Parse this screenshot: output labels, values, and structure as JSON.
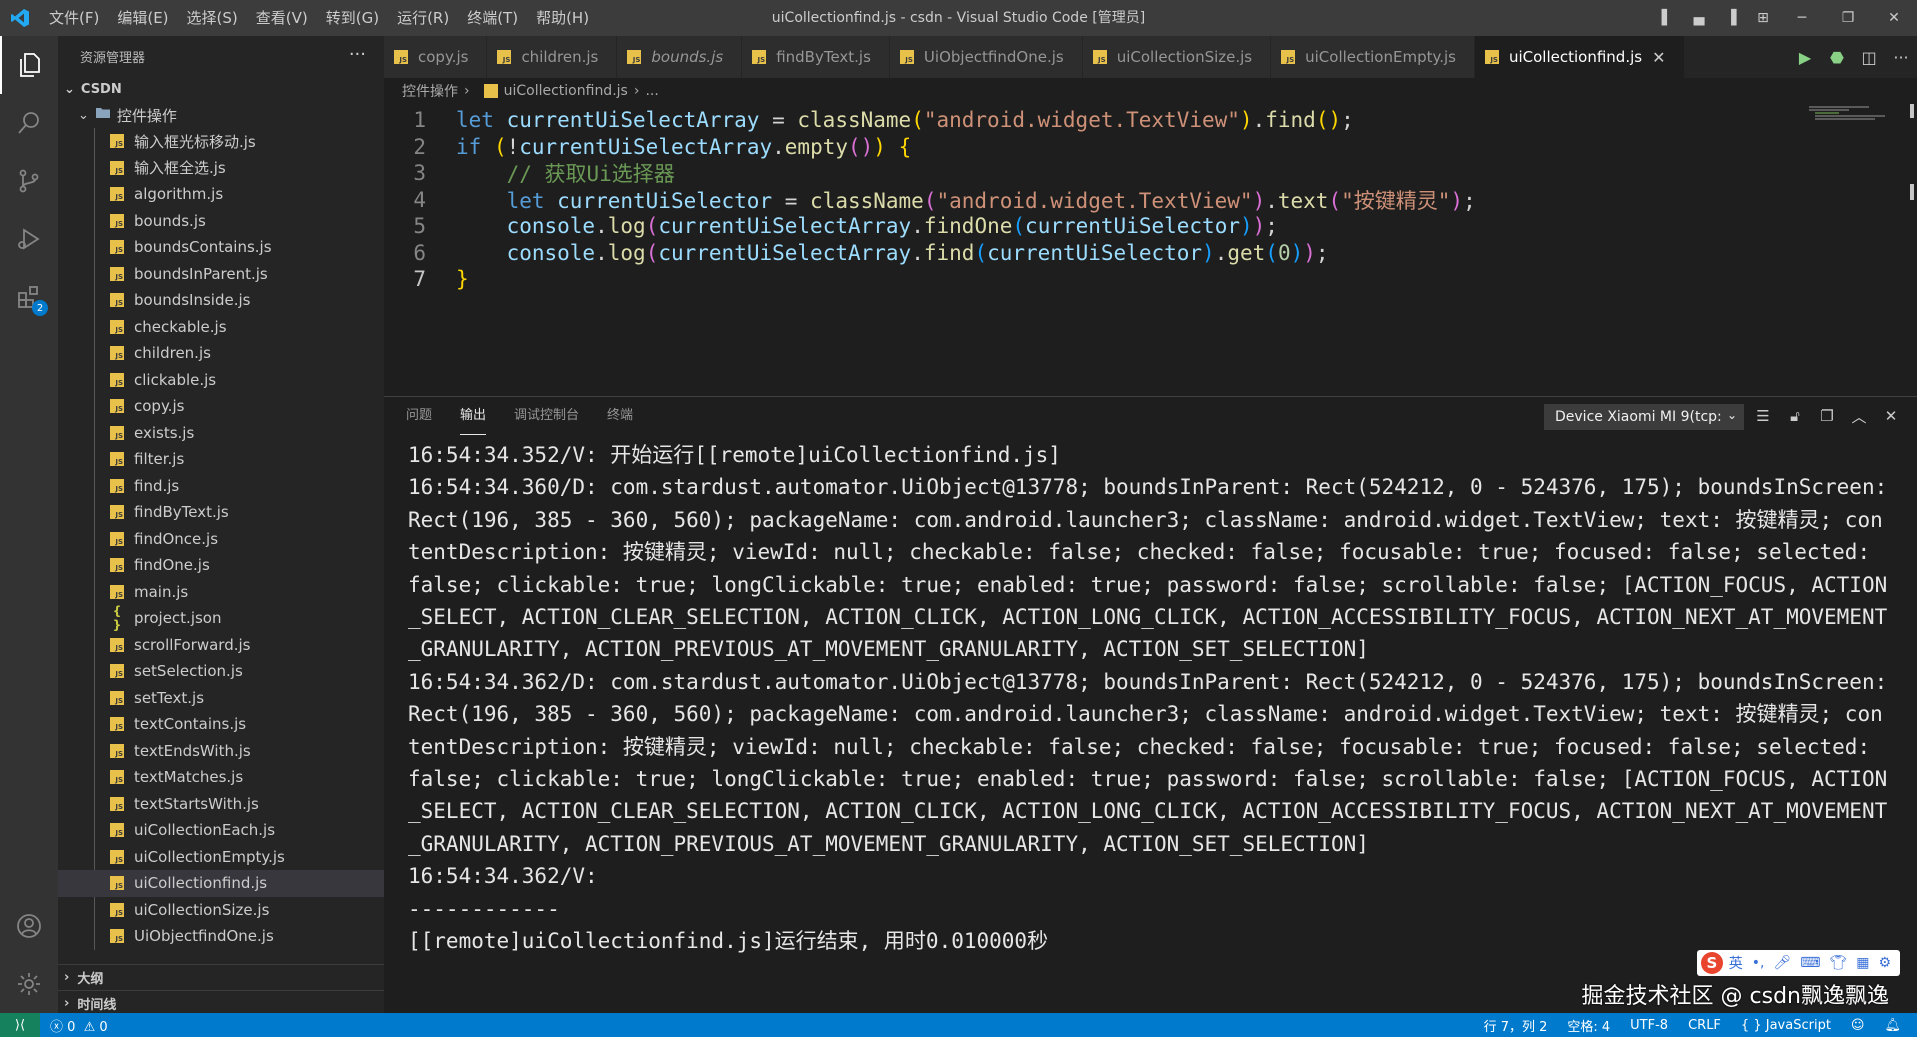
{
  "titlebar": {
    "menu": [
      "文件(F)",
      "编辑(E)",
      "选择(S)",
      "查看(V)",
      "转到(G)",
      "运行(R)",
      "终端(T)",
      "帮助(H)"
    ],
    "title": "uiCollectionfind.js - csdn - Visual Studio Code [管理员]"
  },
  "sidebar": {
    "header": "资源管理器",
    "root": "CSDN",
    "folder": "控件操作",
    "files": [
      {
        "name": "输入框光标移动.js",
        "type": "js"
      },
      {
        "name": "输入框全选.js",
        "type": "js"
      },
      {
        "name": "algorithm.js",
        "type": "js"
      },
      {
        "name": "bounds.js",
        "type": "js"
      },
      {
        "name": "boundsContains.js",
        "type": "js"
      },
      {
        "name": "boundsInParent.js",
        "type": "js"
      },
      {
        "name": "boundsInside.js",
        "type": "js"
      },
      {
        "name": "checkable.js",
        "type": "js"
      },
      {
        "name": "children.js",
        "type": "js"
      },
      {
        "name": "clickable.js",
        "type": "js"
      },
      {
        "name": "copy.js",
        "type": "js"
      },
      {
        "name": "exists.js",
        "type": "js"
      },
      {
        "name": "filter.js",
        "type": "js"
      },
      {
        "name": "find.js",
        "type": "js"
      },
      {
        "name": "findByText.js",
        "type": "js"
      },
      {
        "name": "findOnce.js",
        "type": "js"
      },
      {
        "name": "findOne.js",
        "type": "js"
      },
      {
        "name": "main.js",
        "type": "js"
      },
      {
        "name": "project.json",
        "type": "json"
      },
      {
        "name": "scrollForward.js",
        "type": "js"
      },
      {
        "name": "setSelection.js",
        "type": "js"
      },
      {
        "name": "setText.js",
        "type": "js"
      },
      {
        "name": "textContains.js",
        "type": "js"
      },
      {
        "name": "textEndsWith.js",
        "type": "js"
      },
      {
        "name": "textMatches.js",
        "type": "js"
      },
      {
        "name": "textStartsWith.js",
        "type": "js"
      },
      {
        "name": "uiCollectionEach.js",
        "type": "js"
      },
      {
        "name": "uiCollectionEmpty.js",
        "type": "js"
      },
      {
        "name": "uiCollectionfind.js",
        "type": "js",
        "selected": true
      },
      {
        "name": "uiCollectionSize.js",
        "type": "js"
      },
      {
        "name": "UiObjectfindOne.js",
        "type": "js"
      }
    ],
    "outline": "大纲",
    "timeline": "时间线"
  },
  "activity": {
    "extensions_badge": "2"
  },
  "tabs": [
    {
      "name": "copy.js"
    },
    {
      "name": "children.js"
    },
    {
      "name": "bounds.js",
      "italic": true
    },
    {
      "name": "findByText.js"
    },
    {
      "name": "UiObjectfindOne.js"
    },
    {
      "name": "uiCollectionSize.js"
    },
    {
      "name": "uiCollectionEmpty.js"
    },
    {
      "name": "uiCollectionfind.js",
      "active": true
    }
  ],
  "breadcrumb": {
    "folder": "控件操作",
    "file": "uiCollectionfind.js",
    "tail": "..."
  },
  "editor": {
    "lines": [
      [
        [
          "kw",
          "let "
        ],
        [
          "var",
          "currentUiSelectArray"
        ],
        [
          "code",
          " = "
        ],
        [
          "fn",
          "className"
        ],
        [
          "br1",
          "("
        ],
        [
          "str",
          "\"android.widget.TextView\""
        ],
        [
          "br1",
          ")"
        ],
        [
          "code",
          "."
        ],
        [
          "fn",
          "find"
        ],
        [
          "br1",
          "()"
        ],
        [
          "code",
          ";"
        ]
      ],
      [
        [
          "kw",
          "if "
        ],
        [
          "br1",
          "("
        ],
        [
          "code",
          "!"
        ],
        [
          "var",
          "currentUiSelectArray"
        ],
        [
          "code",
          "."
        ],
        [
          "fn",
          "empty"
        ],
        [
          "br",
          "()"
        ],
        [
          "br1",
          ")"
        ],
        [
          "code",
          " "
        ],
        [
          "br1",
          "{"
        ]
      ],
      [
        [
          "code",
          "    "
        ],
        [
          "cmt",
          "// 获取Ui选择器"
        ]
      ],
      [
        [
          "code",
          "    "
        ],
        [
          "kw",
          "let "
        ],
        [
          "var",
          "currentUiSelector"
        ],
        [
          "code",
          " = "
        ],
        [
          "fn",
          "className"
        ],
        [
          "br",
          "("
        ],
        [
          "str",
          "\"android.widget.TextView\""
        ],
        [
          "br",
          ")"
        ],
        [
          "code",
          "."
        ],
        [
          "fn",
          "text"
        ],
        [
          "br",
          "("
        ],
        [
          "str",
          "\"按键精灵\""
        ],
        [
          "br",
          ")"
        ],
        [
          "code",
          ";"
        ]
      ],
      [
        [
          "code",
          "    "
        ],
        [
          "var",
          "console"
        ],
        [
          "code",
          "."
        ],
        [
          "fn",
          "log"
        ],
        [
          "br",
          "("
        ],
        [
          "var",
          "currentUiSelectArray"
        ],
        [
          "code",
          "."
        ],
        [
          "fn",
          "findOne"
        ],
        [
          "br2",
          "("
        ],
        [
          "var",
          "currentUiSelector"
        ],
        [
          "br2",
          ")"
        ],
        [
          "br",
          ")"
        ],
        [
          "code",
          ";"
        ]
      ],
      [
        [
          "code",
          "    "
        ],
        [
          "var",
          "console"
        ],
        [
          "code",
          "."
        ],
        [
          "fn",
          "log"
        ],
        [
          "br",
          "("
        ],
        [
          "var",
          "currentUiSelectArray"
        ],
        [
          "code",
          "."
        ],
        [
          "fn",
          "find"
        ],
        [
          "br2",
          "("
        ],
        [
          "var",
          "currentUiSelector"
        ],
        [
          "br2",
          ")"
        ],
        [
          "code",
          "."
        ],
        [
          "fn",
          "get"
        ],
        [
          "br2",
          "("
        ],
        [
          "num",
          "0"
        ],
        [
          "br2",
          ")"
        ],
        [
          "br",
          ")"
        ],
        [
          "code",
          ";"
        ]
      ],
      [
        [
          "br1",
          "}"
        ]
      ]
    ]
  },
  "panel": {
    "tabs": [
      "问题",
      "输出",
      "调试控制台",
      "终端"
    ],
    "active_tab": "输出",
    "device": "Device Xiaomi MI 9(tcp:",
    "output": "16:54:34.352/V: 开始运行[[remote]uiCollectionfind.js]\n16:54:34.360/D: com.stardust.automator.UiObject@13778; boundsInParent: Rect(524212, 0 - 524376, 175); boundsInScreen: Rect(196, 385 - 360, 560); packageName: com.android.launcher3; className: android.widget.TextView; text: 按键精灵; contentDescription: 按键精灵; viewId: null; checkable: false; checked: false; focusable: true; focused: false; selected: false; clickable: true; longClickable: true; enabled: true; password: false; scrollable: false; [ACTION_FOCUS, ACTION_SELECT, ACTION_CLEAR_SELECTION, ACTION_CLICK, ACTION_LONG_CLICK, ACTION_ACCESSIBILITY_FOCUS, ACTION_NEXT_AT_MOVEMENT_GRANULARITY, ACTION_PREVIOUS_AT_MOVEMENT_GRANULARITY, ACTION_SET_SELECTION]\n16:54:34.362/D: com.stardust.automator.UiObject@13778; boundsInParent: Rect(524212, 0 - 524376, 175); boundsInScreen: Rect(196, 385 - 360, 560); packageName: com.android.launcher3; className: android.widget.TextView; text: 按键精灵; contentDescription: 按键精灵; viewId: null; checkable: false; checked: false; focusable: true; focused: false; selected: false; clickable: true; longClickable: true; enabled: true; password: false; scrollable: false; [ACTION_FOCUS, ACTION_SELECT, ACTION_CLEAR_SELECTION, ACTION_CLICK, ACTION_LONG_CLICK, ACTION_ACCESSIBILITY_FOCUS, ACTION_NEXT_AT_MOVEMENT_GRANULARITY, ACTION_PREVIOUS_AT_MOVEMENT_GRANULARITY, ACTION_SET_SELECTION]\n16:54:34.362/V: \n------------\n[[remote]uiCollectionfind.js]运行结束, 用时0.010000秒"
  },
  "overlay": {
    "ime_lang": "英",
    "watermark": "掘金技术社区 @ csdn飘逸飘逸"
  },
  "statusbar": {
    "errors": "0",
    "warnings": "0",
    "position": "行 7，列 2",
    "spaces": "空格: 4",
    "encoding": "UTF-8",
    "eol": "CRLF",
    "language": "JavaScript"
  }
}
